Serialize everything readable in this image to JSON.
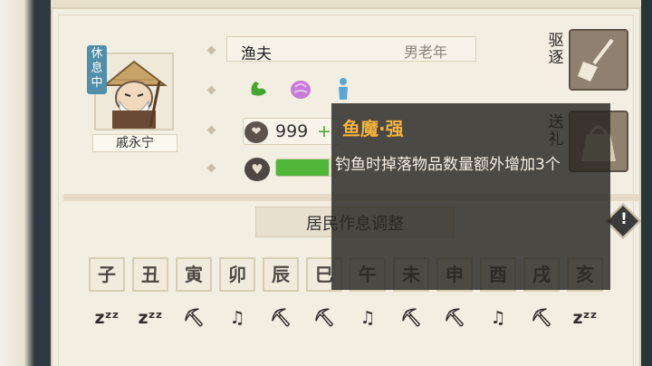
{
  "resident": {
    "name": "戚永宁",
    "status_badge": "休息中",
    "job": "渔夫",
    "age_group": "男老年",
    "coins": "999",
    "coins_plus": "+",
    "traits": [
      "muscle-trait-icon",
      "brain-trait-icon",
      "figure-trait-icon"
    ],
    "health_ratio": 0.85
  },
  "actions": {
    "expel_label": "驱逐",
    "gift_label": "送礼"
  },
  "tooltip": {
    "title": "鱼魔·强",
    "description": "钓鱼时掉落物品数量额外增加3个"
  },
  "schedule": {
    "title": "居民作息调整",
    "info_glyph": "!",
    "hours": [
      "子",
      "丑",
      "寅",
      "卯",
      "辰",
      "巳",
      "午",
      "未",
      "申",
      "酉",
      "戌",
      "亥"
    ],
    "activities": [
      {
        "type": "sleep",
        "glyph": "zᶻᶻ"
      },
      {
        "type": "sleep",
        "glyph": "zᶻᶻ"
      },
      {
        "type": "work",
        "glyph": "⛏"
      },
      {
        "type": "leisure",
        "glyph": "♫"
      },
      {
        "type": "work",
        "glyph": "⛏"
      },
      {
        "type": "work",
        "glyph": "⛏"
      },
      {
        "type": "leisure",
        "glyph": "♫"
      },
      {
        "type": "work",
        "glyph": "⛏"
      },
      {
        "type": "work",
        "glyph": "⛏"
      },
      {
        "type": "leisure",
        "glyph": "♫"
      },
      {
        "type": "work",
        "glyph": "⛏"
      },
      {
        "type": "sleep",
        "glyph": "zᶻᶻ"
      }
    ]
  },
  "colors": {
    "accent_gold": "#f3b23c",
    "health_green": "#4fb63a",
    "plus_green": "#4ca334",
    "rest_badge": "#4f8fa9"
  }
}
